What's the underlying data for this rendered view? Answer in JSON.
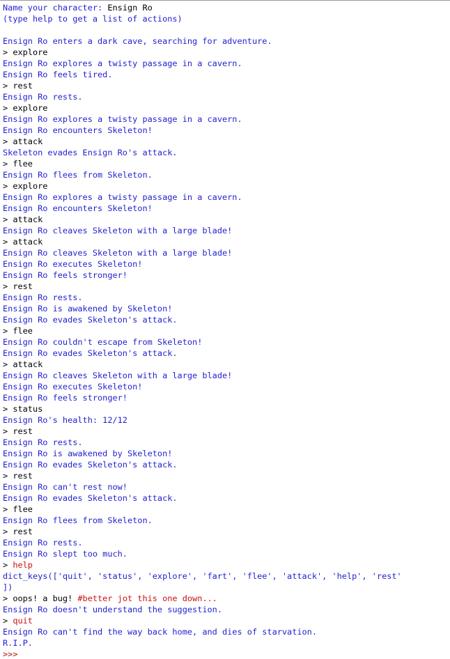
{
  "console": {
    "colors": {
      "stdout": "#1f1fd0",
      "input": "#000000",
      "keyword": "#cc1111",
      "comment": "#cc1111",
      "prompt": "#b01010"
    },
    "lines": [
      {
        "kind": "stdout",
        "text": "Name your character: "
      },
      {
        "kind": "stdout",
        "text": "(type help to get a list of actions)"
      },
      {
        "kind": "blank",
        "text": ""
      },
      {
        "kind": "stdout",
        "text": "Ensign Ro enters a dark cave, searching for adventure."
      },
      {
        "kind": "input",
        "text": "> explore"
      },
      {
        "kind": "stdout",
        "text": "Ensign Ro explores a twisty passage in a cavern."
      },
      {
        "kind": "stdout",
        "text": "Ensign Ro feels tired."
      },
      {
        "kind": "input",
        "text": "> rest"
      },
      {
        "kind": "stdout",
        "text": "Ensign Ro rests."
      },
      {
        "kind": "input",
        "text": "> explore"
      },
      {
        "kind": "stdout",
        "text": "Ensign Ro explores a twisty passage in a cavern."
      },
      {
        "kind": "stdout",
        "text": "Ensign Ro encounters Skeleton!"
      },
      {
        "kind": "input",
        "text": "> attack"
      },
      {
        "kind": "stdout",
        "text": "Skeleton evades Ensign Ro's attack."
      },
      {
        "kind": "input",
        "text": "> flee"
      },
      {
        "kind": "stdout",
        "text": "Ensign Ro flees from Skeleton."
      },
      {
        "kind": "input",
        "text": "> explore"
      },
      {
        "kind": "stdout",
        "text": "Ensign Ro explores a twisty passage in a cavern."
      },
      {
        "kind": "stdout",
        "text": "Ensign Ro encounters Skeleton!"
      },
      {
        "kind": "input",
        "text": "> attack"
      },
      {
        "kind": "stdout",
        "text": "Ensign Ro cleaves Skeleton with a large blade!"
      },
      {
        "kind": "input",
        "text": "> attack"
      },
      {
        "kind": "stdout",
        "text": "Ensign Ro cleaves Skeleton with a large blade!"
      },
      {
        "kind": "stdout",
        "text": "Ensign Ro executes Skeleton!"
      },
      {
        "kind": "stdout",
        "text": "Ensign Ro feels stronger!"
      },
      {
        "kind": "input",
        "text": "> rest"
      },
      {
        "kind": "stdout",
        "text": "Ensign Ro rests."
      },
      {
        "kind": "stdout",
        "text": "Ensign Ro is awakened by Skeleton!"
      },
      {
        "kind": "stdout",
        "text": "Ensign Ro evades Skeleton's attack."
      },
      {
        "kind": "input",
        "text": "> flee"
      },
      {
        "kind": "stdout",
        "text": "Ensign Ro couldn't escape from Skeleton!"
      },
      {
        "kind": "stdout",
        "text": "Ensign Ro evades Skeleton's attack."
      },
      {
        "kind": "input",
        "text": "> attack"
      },
      {
        "kind": "stdout",
        "text": "Ensign Ro cleaves Skeleton with a large blade!"
      },
      {
        "kind": "stdout",
        "text": "Ensign Ro executes Skeleton!"
      },
      {
        "kind": "stdout",
        "text": "Ensign Ro feels stronger!"
      },
      {
        "kind": "input",
        "text": "> status"
      },
      {
        "kind": "stdout",
        "text": "Ensign Ro's health: 12/12"
      },
      {
        "kind": "input",
        "text": "> rest"
      },
      {
        "kind": "stdout",
        "text": "Ensign Ro rests."
      },
      {
        "kind": "stdout",
        "text": "Ensign Ro is awakened by Skeleton!"
      },
      {
        "kind": "stdout",
        "text": "Ensign Ro evades Skeleton's attack."
      },
      {
        "kind": "input",
        "text": "> rest"
      },
      {
        "kind": "stdout",
        "text": "Ensign Ro can't rest now!"
      },
      {
        "kind": "stdout",
        "text": "Ensign Ro evades Skeleton's attack."
      },
      {
        "kind": "input",
        "text": "> flee"
      },
      {
        "kind": "stdout",
        "text": "Ensign Ro flees from Skeleton."
      },
      {
        "kind": "input",
        "text": "> rest"
      },
      {
        "kind": "stdout",
        "text": "Ensign Ro rests."
      },
      {
        "kind": "stdout",
        "text": "Ensign Ro slept too much."
      },
      {
        "kind": "input-keyword",
        "prefix": "> ",
        "text": "help"
      },
      {
        "kind": "stdout",
        "text": "dict_keys(['quit', 'status', 'explore', 'fart', 'flee', 'attack', 'help', 'rest'"
      },
      {
        "kind": "stdout",
        "text": "])"
      },
      {
        "kind": "input-comment",
        "prefix": "> oops! a bug! ",
        "text": "#better jot this one down..."
      },
      {
        "kind": "stdout",
        "text": "Ensign Ro doesn't understand the suggestion."
      },
      {
        "kind": "input-keyword",
        "prefix": "> ",
        "text": "quit"
      },
      {
        "kind": "stdout",
        "text": "Ensign Ro can't find the way back home, and dies of starvation."
      },
      {
        "kind": "stdout",
        "text": "R.I.P."
      },
      {
        "kind": "prompt",
        "text": ">>> "
      }
    ],
    "name_entry": "Ensign Ro"
  }
}
